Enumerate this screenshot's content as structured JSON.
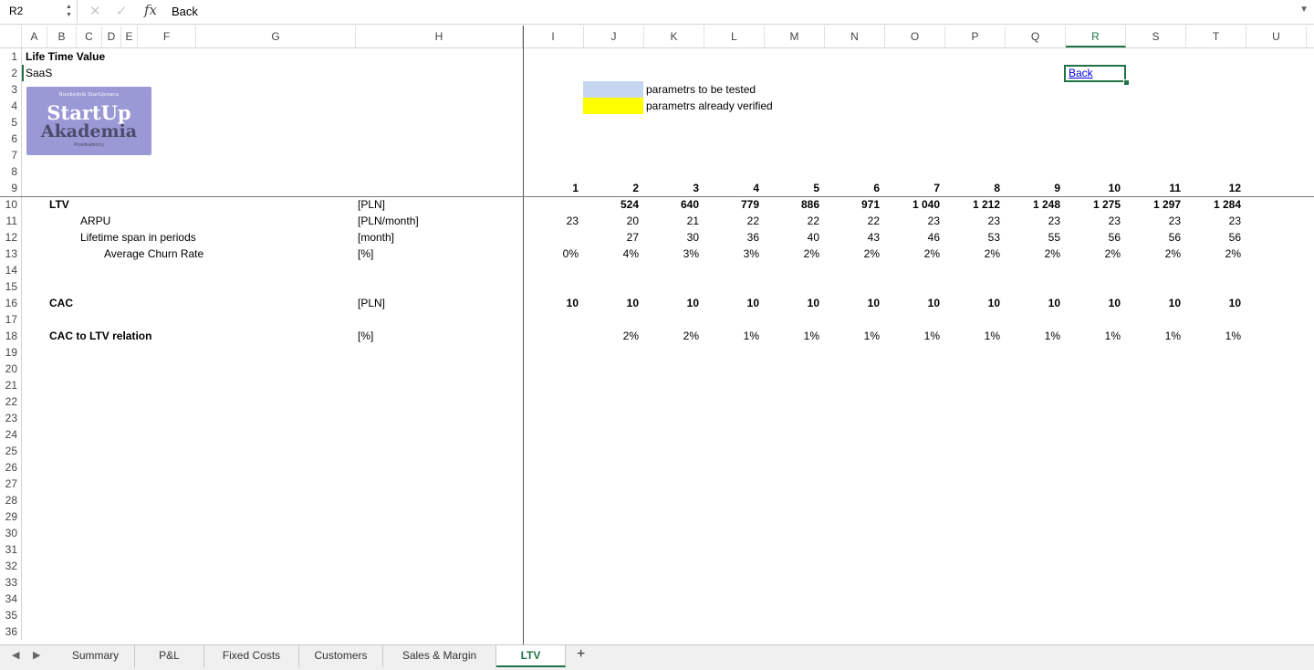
{
  "formula_bar": {
    "name_box": "R2",
    "fx_label": "fx",
    "value": "Back"
  },
  "columns": [
    "A",
    "B",
    "C",
    "D",
    "E",
    "F",
    "G",
    "H",
    "I",
    "J",
    "K",
    "L",
    "M",
    "N",
    "O",
    "P",
    "Q",
    "R",
    "S",
    "T",
    "U"
  ],
  "selected_column": "R",
  "row_numbers": [
    "1",
    "2",
    "3",
    "4",
    "5",
    "6",
    "7",
    "8",
    "9",
    "10",
    "11",
    "12",
    "13",
    "14",
    "15",
    "16",
    "17",
    "18",
    "19",
    "20",
    "21",
    "22",
    "23",
    "24",
    "25",
    "26",
    "27",
    "28",
    "29",
    "30",
    "31",
    "32",
    "33",
    "34",
    "35",
    "36"
  ],
  "sheet": {
    "title": "Life Time Value",
    "subtitle": "SaaS",
    "back_link": "Back",
    "logo": {
      "top": "Niezbędnik StartUpowca",
      "line1": "StartUp",
      "line2": "Akademia",
      "bottom": "Przedsiębiorcy"
    },
    "legend": {
      "blue_label": "parametrs to be tested",
      "yellow_label": "parametrs already verified",
      "blue_color": "#c5d6f0",
      "yellow_color": "#ffff00"
    },
    "periods": [
      "1",
      "2",
      "3",
      "4",
      "5",
      "6",
      "7",
      "8",
      "9",
      "10",
      "11",
      "12"
    ],
    "rows": [
      {
        "label": "LTV",
        "unit": "[PLN]",
        "values": [
          "",
          "524",
          "640",
          "779",
          "886",
          "971",
          "1 040",
          "1 212",
          "1 248",
          "1 275",
          "1 297",
          "1 284"
        ]
      },
      {
        "label": "ARPU",
        "unit": "[PLN/month]",
        "values": [
          "23",
          "20",
          "21",
          "22",
          "22",
          "22",
          "23",
          "23",
          "23",
          "23",
          "23",
          "23"
        ]
      },
      {
        "label": "Lifetime span in periods",
        "unit": "[month]",
        "values": [
          "",
          "27",
          "30",
          "36",
          "40",
          "43",
          "46",
          "53",
          "55",
          "56",
          "56",
          "56"
        ]
      },
      {
        "label": "Average Churn Rate",
        "unit": "[%]",
        "values": [
          "0%",
          "4%",
          "3%",
          "3%",
          "2%",
          "2%",
          "2%",
          "2%",
          "2%",
          "2%",
          "2%",
          "2%"
        ]
      },
      {
        "label": "CAC",
        "unit": "[PLN]",
        "values": [
          "10",
          "10",
          "10",
          "10",
          "10",
          "10",
          "10",
          "10",
          "10",
          "10",
          "10",
          "10"
        ]
      },
      {
        "label": "CAC to LTV relation",
        "unit": "[%]",
        "values": [
          "",
          "2%",
          "2%",
          "1%",
          "1%",
          "1%",
          "1%",
          "1%",
          "1%",
          "1%",
          "1%",
          "1%"
        ]
      }
    ]
  },
  "tabs": [
    "Summary",
    "P&L",
    "Fixed Costs",
    "Customers",
    "Sales & Margin",
    "LTV"
  ],
  "active_tab": "LTV",
  "add_tab_label": "+",
  "accent_color": "#217346"
}
